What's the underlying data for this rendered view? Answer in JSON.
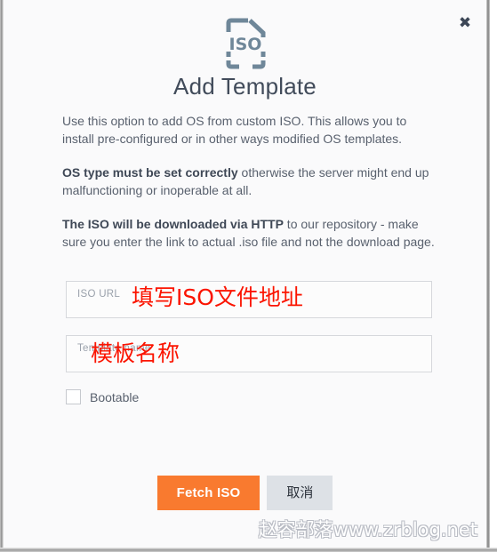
{
  "dialog": {
    "title": "Add Template",
    "close_label": "✖",
    "icon_name": "iso-file-icon",
    "icon_text": "ISO"
  },
  "description": {
    "paragraph1": "Use this option to add OS from custom ISO. This allows you to install pre-configured or in other ways modified OS templates.",
    "paragraph2_bold": "OS type must be set correctly",
    "paragraph2_rest": " otherwise the server might end up malfunctioning or inoperable at all.",
    "paragraph3_bold": "The ISO will be downloaded via HTTP",
    "paragraph3_rest": " to our repository - make sure you enter the link to actual .iso file and not the download page."
  },
  "form": {
    "iso_url": {
      "label": "ISO URL",
      "value": "",
      "annotation": "填写ISO文件地址"
    },
    "template_name": {
      "label": "Template name",
      "value": "",
      "annotation": "模板名称"
    },
    "bootable": {
      "label": "Bootable",
      "checked": false
    }
  },
  "actions": {
    "primary": "Fetch ISO",
    "secondary": "取消"
  },
  "watermark": {
    "text": "赵容部落www.zrblog.net"
  },
  "colors": {
    "accent": "#f97a2f",
    "annotation_red": "#fb1400",
    "icon_slate": "#6f8799",
    "text": "#59616e",
    "heading": "#414b5a"
  }
}
